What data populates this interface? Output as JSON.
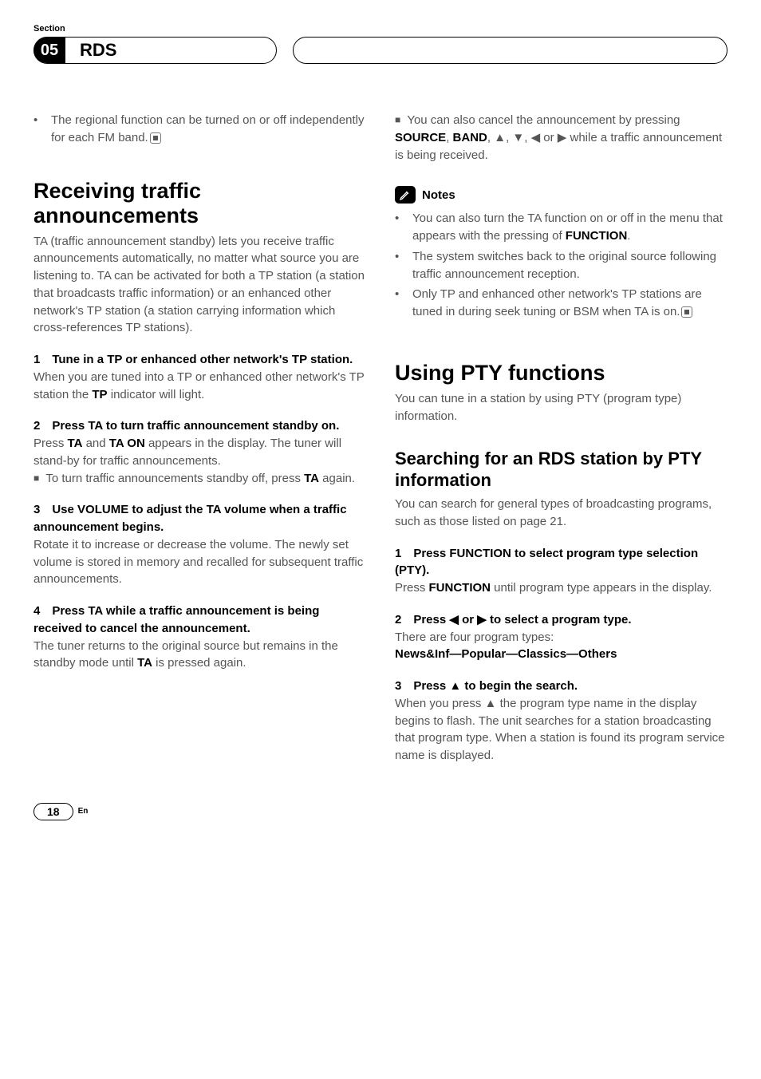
{
  "section_label": "Section",
  "header": {
    "number": "05",
    "title": "RDS"
  },
  "left": {
    "top_bullet": "The regional function can be turned on or off independently for each FM band.",
    "h_receiving": "Receiving traffic announcements",
    "p_receiving": "TA (traffic announcement standby) lets you receive traffic announcements automatically, no matter what source you are listening to. TA can be activated for both a TP station (a station that broadcasts traffic information) or an enhanced other network's TP station (a station carrying information which cross-references TP stations).",
    "step1_head": "1 Tune in a TP or enhanced other network's TP station.",
    "step1_body_a": "When you are tuned into a TP or enhanced other network's TP station the ",
    "step1_body_tp": "TP",
    "step1_body_b": " indicator will light.",
    "step2_head": "2 Press TA to turn traffic announcement standby on.",
    "step2_body_a": "Press ",
    "step2_ta": "TA",
    "step2_body_b": " and ",
    "step2_taon": "TA ON",
    "step2_body_c": " appears in the display. The tuner will stand-by for traffic announcements.",
    "step2_sub_a": "To turn traffic announcements standby off, press ",
    "step2_sub_ta": "TA",
    "step2_sub_b": " again.",
    "step3_head": "3 Use VOLUME to adjust the TA volume when a traffic announcement begins.",
    "step3_body": "Rotate it to increase or decrease the volume. The newly set volume is stored in memory and recalled for subsequent traffic announcements.",
    "step4_head": "4 Press TA while a traffic announcement is being received to cancel the announcement.",
    "step4_body_a": "The tuner returns to the original source but remains in the standby mode until ",
    "step4_ta": "TA",
    "step4_body_b": " is pressed again."
  },
  "right": {
    "top_sub_a": "You can also cancel the announcement by pressing ",
    "top_source": "SOURCE",
    "top_sep1": ", ",
    "top_band": "BAND",
    "top_sep2": ", ",
    "top_arrows": "▲, ▼, ◀ or ▶",
    "top_sub_b": " while a traffic announcement is being received.",
    "notes_label": "Notes",
    "note1_a": "You can also turn the TA function on or off in the menu that appears with the pressing of ",
    "note1_func": "FUNCTION",
    "note1_b": ".",
    "note2": "The system switches back to the original source following traffic announcement reception.",
    "note3": "Only TP and enhanced other network's TP stations are tuned in during seek tuning or BSM when TA is on.",
    "h_pty": "Using PTY functions",
    "p_pty": "You can tune in a station by using PTY (program type) information.",
    "h_search": "Searching for an RDS station by PTY information",
    "p_search": "You can search for general types of broadcasting programs, such as those listed on page 21.",
    "s1_head": "1 Press FUNCTION to select program type selection (PTY).",
    "s1_body_a": "Press ",
    "s1_func": "FUNCTION",
    "s1_body_b": " until program type appears in the display.",
    "s2_head": "2 Press ◀ or ▶ to select a program type.",
    "s2_body": "There are four program types:",
    "s2_list": "News&Inf—Popular—Classics—Others",
    "s3_head": "3 Press ▲ to begin the search.",
    "s3_body": "When you press ▲ the program type name in the display begins to flash. The unit searches for a station broadcasting that program type. When a station is found its program service name is displayed."
  },
  "footer": {
    "page": "18",
    "lang": "En"
  }
}
